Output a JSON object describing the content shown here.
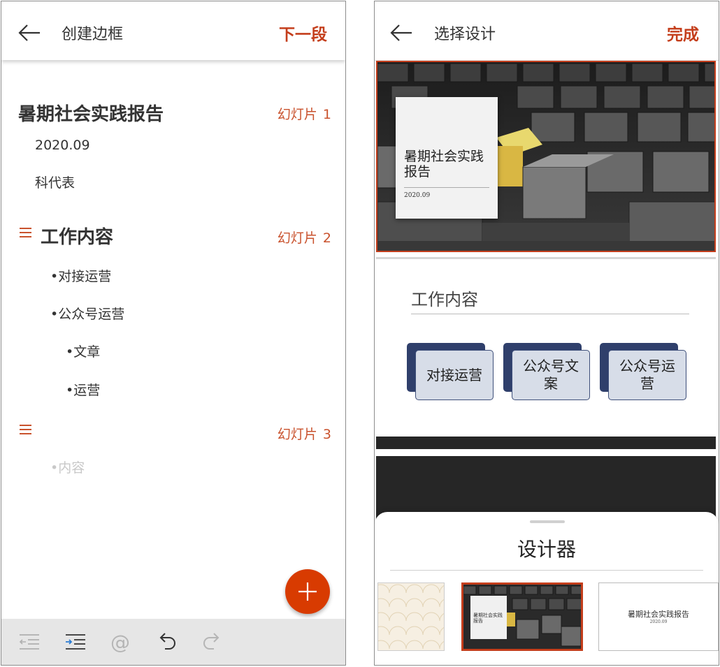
{
  "left": {
    "header": {
      "title": "创建边框",
      "action": "下一段"
    },
    "slides": [
      {
        "label": "幻灯片",
        "num": "1",
        "title": "暑期社会实践报告",
        "lines": [
          "2020.09",
          "科代表"
        ]
      },
      {
        "label": "幻灯片",
        "num": "2",
        "title": "工作内容",
        "bullets": [
          "•对接运营",
          "•公众号运营",
          "•文章",
          "•运营"
        ]
      },
      {
        "label": "幻灯片",
        "num": "3",
        "title": "",
        "placeholder": "•内容"
      }
    ],
    "fab_icon": "plus-icon",
    "toolbar_icons": [
      "outdent-icon",
      "indent-icon",
      "at-icon",
      "undo-icon",
      "redo-icon"
    ],
    "toolbar_at": "@"
  },
  "right": {
    "header": {
      "title": "选择设计",
      "action": "完成"
    },
    "slide1": {
      "title": "暑期社会实践报告",
      "date": "2020.09"
    },
    "slide2": {
      "title": "工作内容",
      "boxes": [
        "对接运营",
        "公众号文案",
        "公众号运营"
      ]
    },
    "designer": {
      "title": "设计器",
      "thumb3_title": "暑期社会实践报告",
      "thumb3_date": "2020.09",
      "thumb2_title": "暑期社会实践报告"
    }
  },
  "colors": {
    "accent": "#c43e1c",
    "fab": "#d83b01",
    "box_dark": "#2f3f6b"
  }
}
